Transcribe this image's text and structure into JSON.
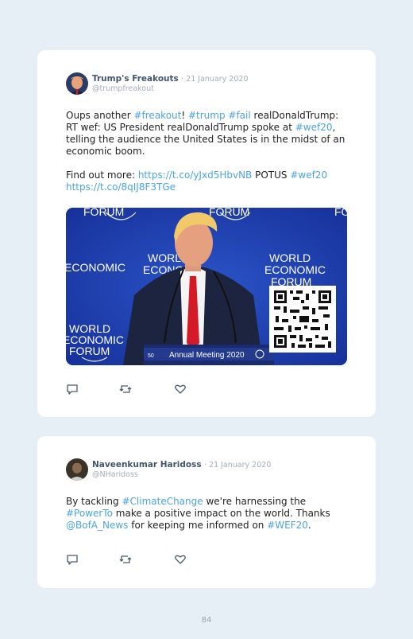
{
  "tweets": [
    {
      "author": "Trump's Freakouts",
      "date": "· 21 January 2020",
      "handle": "@trumpfreakout",
      "p1": [
        {
          "t": "Oups another ",
          "link": false
        },
        {
          "t": "#freakout",
          "link": true
        },
        {
          "t": "! ",
          "link": false
        },
        {
          "t": "#trump",
          "link": true
        },
        {
          "t": " ",
          "link": false
        },
        {
          "t": "#fail",
          "link": true
        },
        {
          "t": " realDonaldTrump: RT wef: US President realDonaldTrump spoke at ",
          "link": false
        },
        {
          "t": "#wef20",
          "link": true
        },
        {
          "t": ", telling the audience the United States is in the midst of an economic boom.",
          "link": false
        }
      ],
      "p2": [
        {
          "t": "Find out more: ",
          "link": false
        },
        {
          "t": "https://t.co/yJxd5HbvNB",
          "link": true
        },
        {
          "t": " POTUS ",
          "link": false
        },
        {
          "t": "#wef20",
          "link": true
        },
        {
          "t": " ",
          "link": false
        },
        {
          "t": "https://t.co/8qIJ8F3TGe",
          "link": true
        }
      ],
      "media": {
        "bg_words": [
          "WORLD",
          "ECONOMIC",
          "FORUM"
        ],
        "banner": "Annual Meeting 2020",
        "banner_badge": "50"
      }
    },
    {
      "author": "Naveenkumar Haridoss",
      "date": "· 21 January 2020",
      "handle": "@NHaridoss",
      "p1": [
        {
          "t": "By tackling ",
          "link": false
        },
        {
          "t": "#ClimateChange",
          "link": true
        },
        {
          "t": " we're harnessing the ",
          "link": false
        },
        {
          "t": "#PowerTo",
          "link": true
        },
        {
          "t": " make a positive impact on the world. Thanks ",
          "link": false
        },
        {
          "t": "@BofA_News",
          "link": true
        },
        {
          "t": " for keeping me informed on ",
          "link": false
        },
        {
          "t": "#WEF20",
          "link": true
        },
        {
          "t": ".",
          "link": false
        }
      ]
    }
  ],
  "colors": {
    "link": "#4aa3e6",
    "name": "#44566c",
    "muted": "#a4adb8",
    "page_bg": "#e6eef6",
    "forum_blue": "#1f3fa8"
  },
  "icons": [
    "reply-icon",
    "retweet-icon",
    "like-icon"
  ],
  "page_number": "84"
}
